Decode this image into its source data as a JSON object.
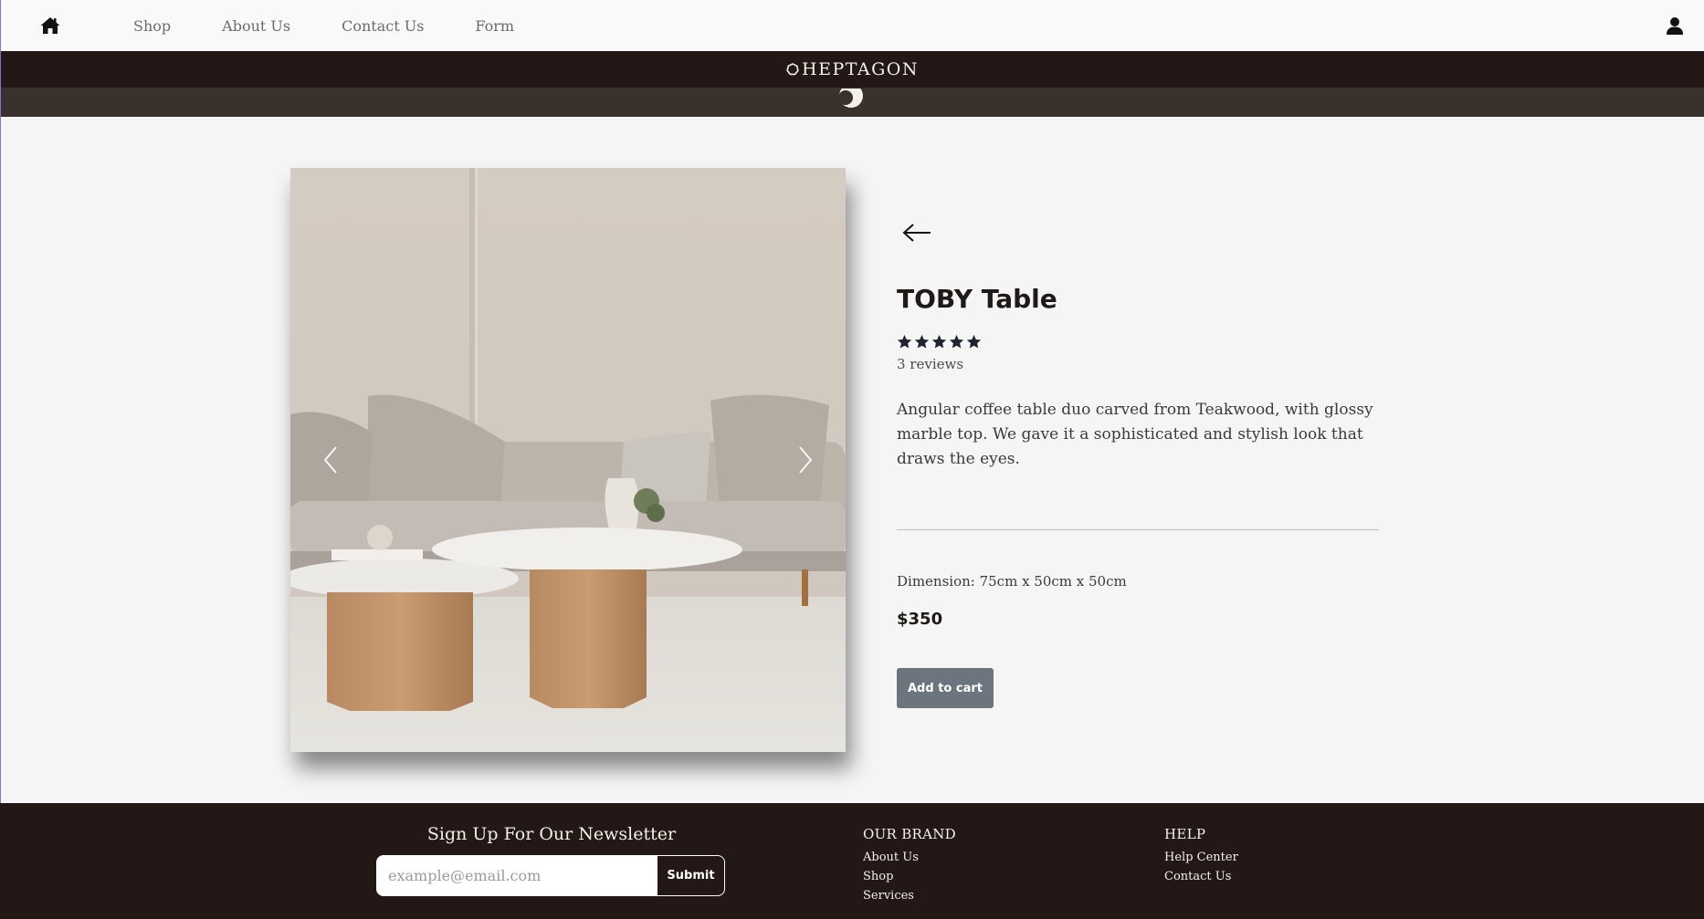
{
  "nav": {
    "links": [
      {
        "label": "Shop"
      },
      {
        "label": "About Us"
      },
      {
        "label": "Contact Us"
      },
      {
        "label": "Form"
      }
    ]
  },
  "brand": {
    "name": "HEPTAGON"
  },
  "product": {
    "title": "TOBY Table",
    "rating": 5,
    "rating_max": 5,
    "reviews": "3 reviews",
    "description": "Angular coffee table duo carved from Teakwood, with glossy marble top. We gave it a sophisticated and stylish look that draws the eyes.",
    "dimension": "Dimension: 75cm x 50cm x 50cm",
    "price": "$350",
    "add_to_cart": "Add to cart"
  },
  "footer": {
    "newsletter_title": "Sign Up For Our Newsletter",
    "email_placeholder": "example@email.com",
    "submit_label": "Submit",
    "brand_heading": "OUR BRAND",
    "brand_links": [
      "About Us",
      "Shop",
      "Services"
    ],
    "help_heading": "HELP",
    "help_links": [
      "Help Center",
      "Contact Us"
    ]
  },
  "colors": {
    "dark": "#231815",
    "subbar": "#3a302c",
    "button": "#6c757d",
    "background": "#f5f5f5"
  }
}
